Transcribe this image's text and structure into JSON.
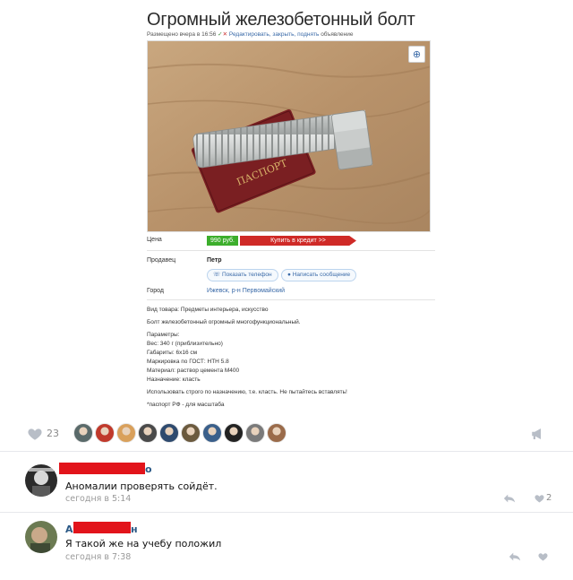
{
  "listing": {
    "title": "Огромный железобетонный болт",
    "meta_posted": "Размещено вчера в 16:56",
    "meta_edit": "Редактировать, закрыть, поднять",
    "meta_suffix": "объявление",
    "price_label": "Цена",
    "price": "990 руб.",
    "credit_button": "Купить в кредит >>",
    "seller_label": "Продавец",
    "seller_name": "Петр",
    "show_phone": "Показать телефон",
    "write_message": "Написать сообщение",
    "city_label": "Город",
    "city": "Ижевск, р-н Первомайский",
    "photo_passport_text": "ПАСПОРТ",
    "description": [
      "Вид товара: Предметы интерьера, искусство",
      "Болт железобетонный огромный многофункциональный.",
      "Параметры:",
      "Вес: 340 г (приблизительно)",
      "Габариты: 6х16 см",
      "Маркировка по ГОСТ: НТН 5.8",
      "Материал: раствор цемента М400",
      "Назначение: класть",
      "Использовать строго по назначению, т.е. класть. Не пытайтесь вставлять!",
      "*паспорт РФ - для масштаба"
    ]
  },
  "post_actions": {
    "like_icon": "heart-icon",
    "like_count": "23",
    "share_icon": "megaphone-icon",
    "liker_colors": [
      "#5a6a6a",
      "#c0392b",
      "#d9a05b",
      "#4a4a4a",
      "#2e4a6e",
      "#6b5a3e",
      "#3a5f8a",
      "#222222",
      "#7a7a7a",
      "#9a6b4a"
    ]
  },
  "comments": [
    {
      "author_visible": "о",
      "text": "Аномалии проверять сойдёт.",
      "time": "сегодня в 5:14",
      "likes": "2",
      "avatar_color": "#2b2b2b"
    },
    {
      "author_visible_start": "А",
      "author_visible_end": "н",
      "text": "Я такой же на учебу положил",
      "time": "сегодня в 7:38",
      "likes": "",
      "avatar_color": "#6b7a52"
    }
  ],
  "colors": {
    "link": "#2a5885",
    "price_green": "#3cae2c",
    "credit_red": "#cf2a27",
    "redaction_red": "#e2141b"
  }
}
